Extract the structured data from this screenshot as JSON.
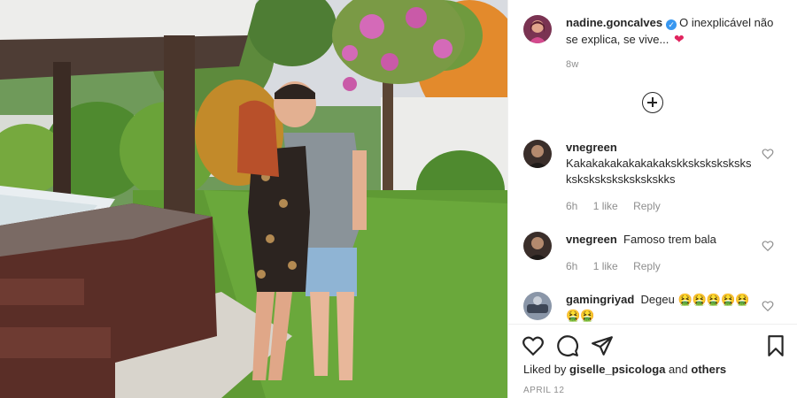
{
  "post": {
    "author": "nadine.goncalves",
    "caption": "O inexplicável não se explica, se vive...",
    "caption_emoji": "❤",
    "age": "8w"
  },
  "comments": [
    {
      "user": "vnegreen",
      "text": "Kakakakakakakakakskkskskskskskskskskskskskskskskks",
      "time": "6h",
      "likes": "1 like",
      "reply": "Reply"
    },
    {
      "user": "vnegreen",
      "text": "Famoso trem bala",
      "time": "6h",
      "likes": "1 like",
      "reply": "Reply"
    },
    {
      "user": "gamingriyad",
      "text": "Degeu 🤮🤮🤮🤮🤮🤮🤮",
      "time": "",
      "likes": "",
      "reply": ""
    }
  ],
  "likes": {
    "prefix": "Liked by",
    "user": "giselle_psicologa",
    "middle": "and",
    "others": "others"
  },
  "date": "APRIL 12",
  "icons": {
    "verified": "verified-badge-icon",
    "load_more": "plus-circle-icon",
    "like": "heart-icon",
    "comment": "comment-bubble-icon",
    "share": "paper-plane-icon",
    "save": "bookmark-icon"
  },
  "colors": {
    "verified": "#3897f0",
    "muted_text": "#8e8e8e",
    "text": "#262626"
  }
}
